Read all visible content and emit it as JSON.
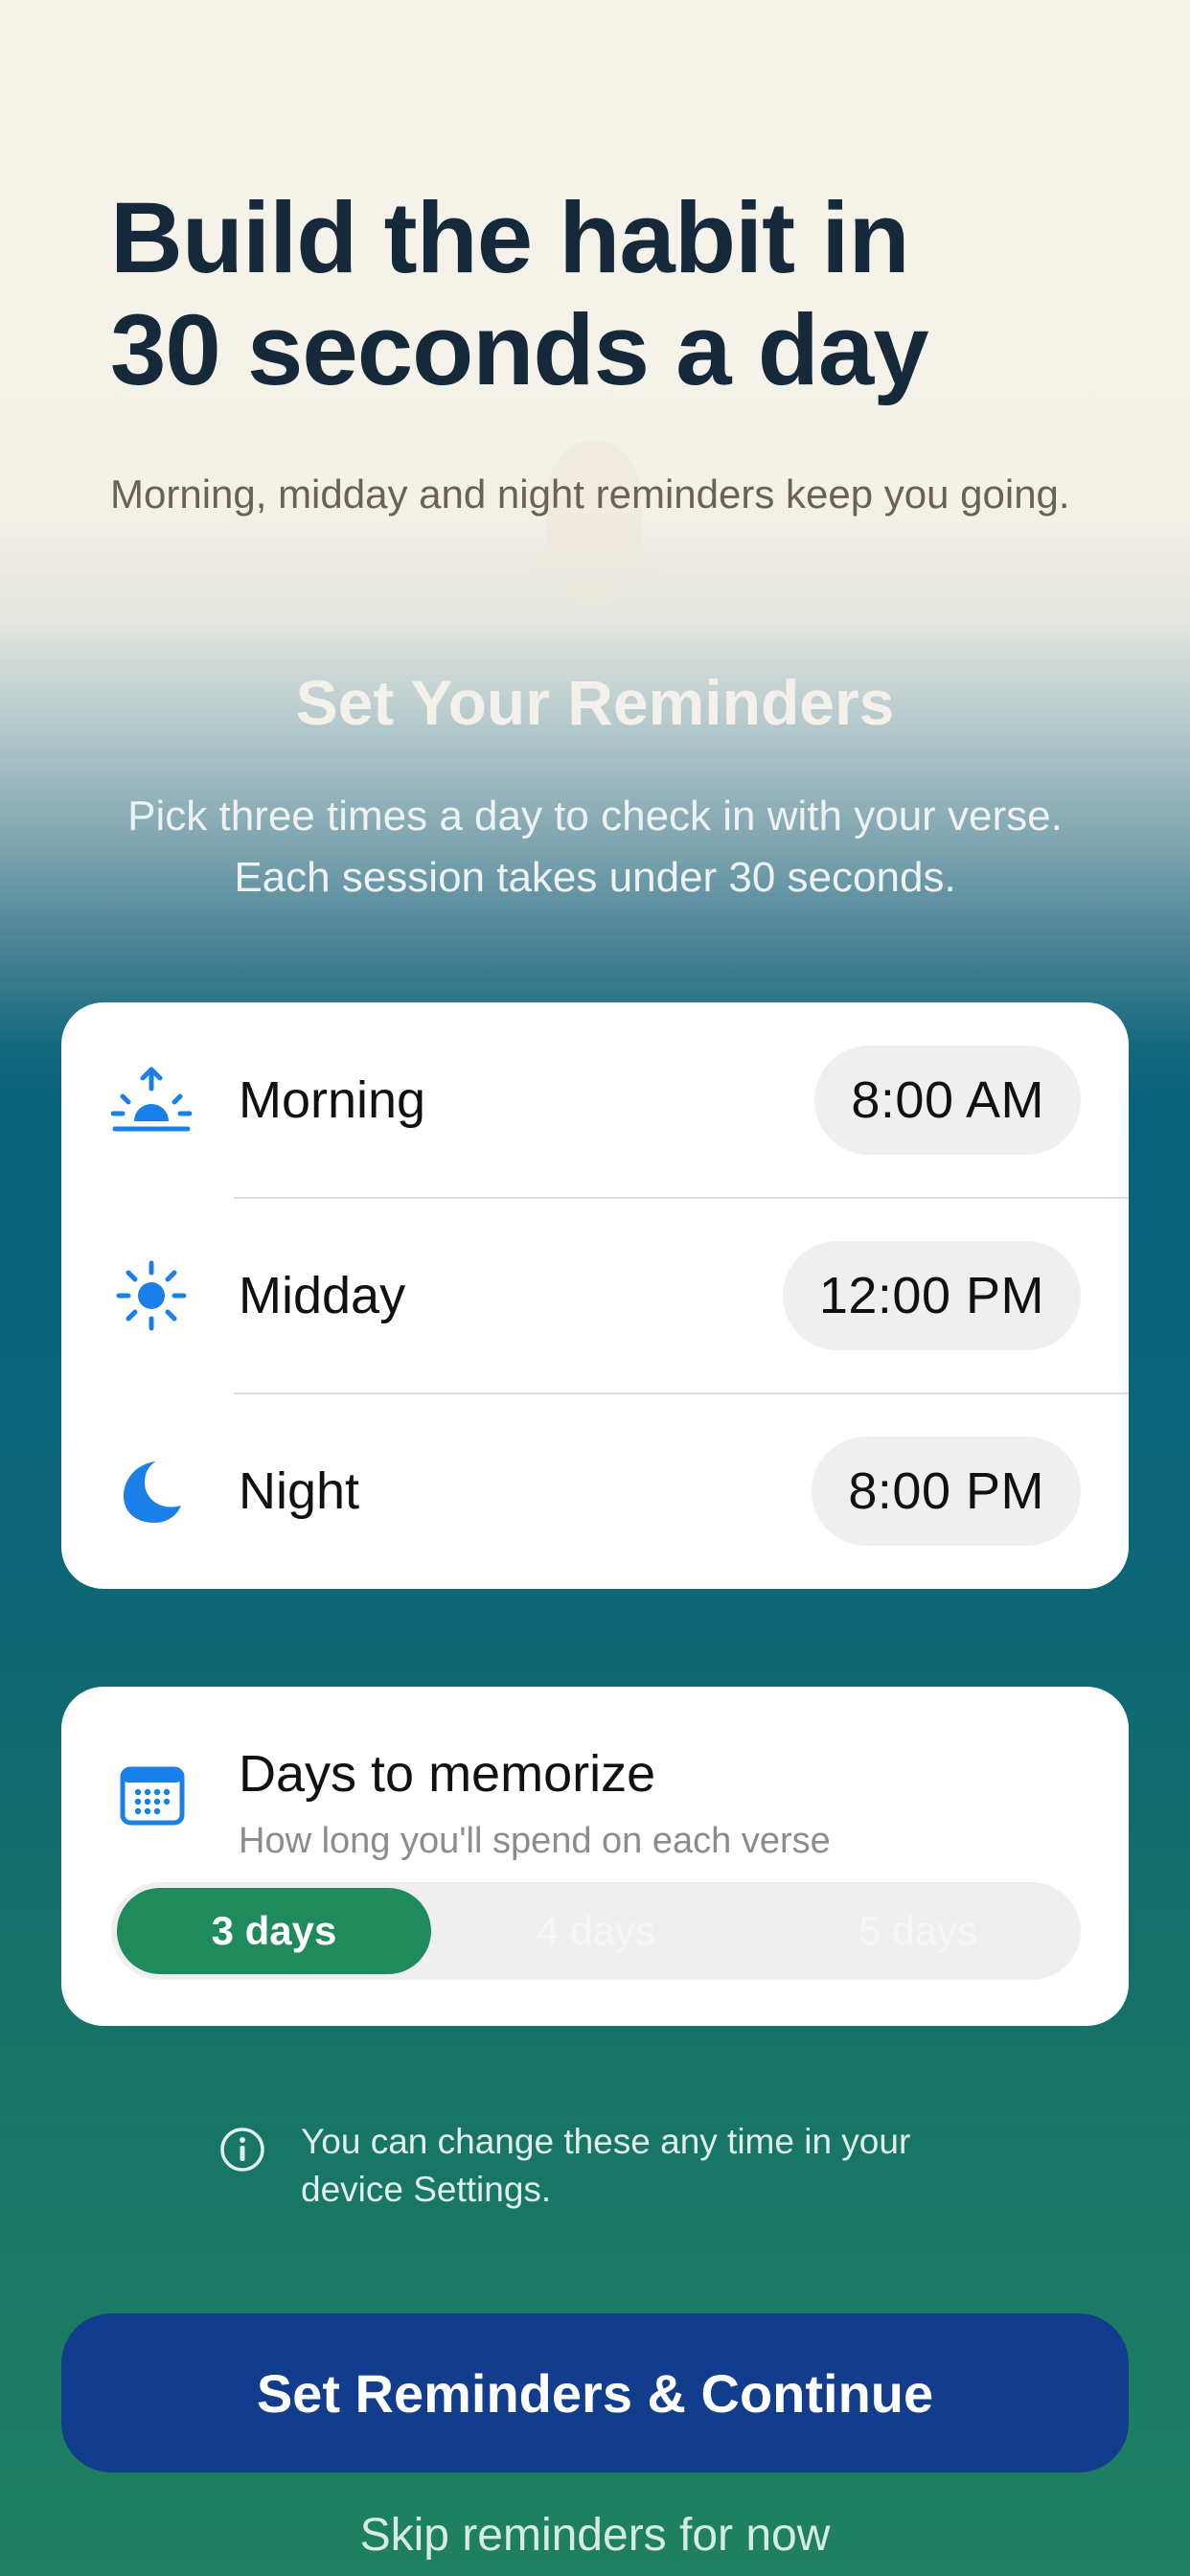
{
  "header": {
    "headline_line1": "Build the habit in",
    "headline_line2": "30 seconds a day",
    "subheadline": "Morning, midday and night reminders keep you going."
  },
  "reminders": {
    "title": "Set Your Reminders",
    "description_line1": "Pick three times a day to check in with your verse.",
    "description_line2": "Each session takes under 30 seconds.",
    "items": [
      {
        "label": "Morning",
        "time": "8:00 AM",
        "icon": "sunrise-icon"
      },
      {
        "label": "Midday",
        "time": "12:00 PM",
        "icon": "sun-icon"
      },
      {
        "label": "Night",
        "time": "8:00 PM",
        "icon": "moon-icon"
      }
    ]
  },
  "days": {
    "title": "Days to memorize",
    "subtitle": "How long you'll spend on each verse",
    "icon": "calendar-icon",
    "options": [
      "3 days",
      "4 days",
      "5 days"
    ],
    "selected": "3 days"
  },
  "note": {
    "icon": "info-icon",
    "text_line1": "You can change these any time in your",
    "text_line2": "device Settings."
  },
  "actions": {
    "primary": "Set Reminders & Continue",
    "skip": "Skip reminders for now"
  },
  "colors": {
    "accent_blue": "#1a7fe8",
    "selected_green": "#1f8a5c",
    "primary_button": "#123d8c",
    "headline": "#16293b"
  }
}
